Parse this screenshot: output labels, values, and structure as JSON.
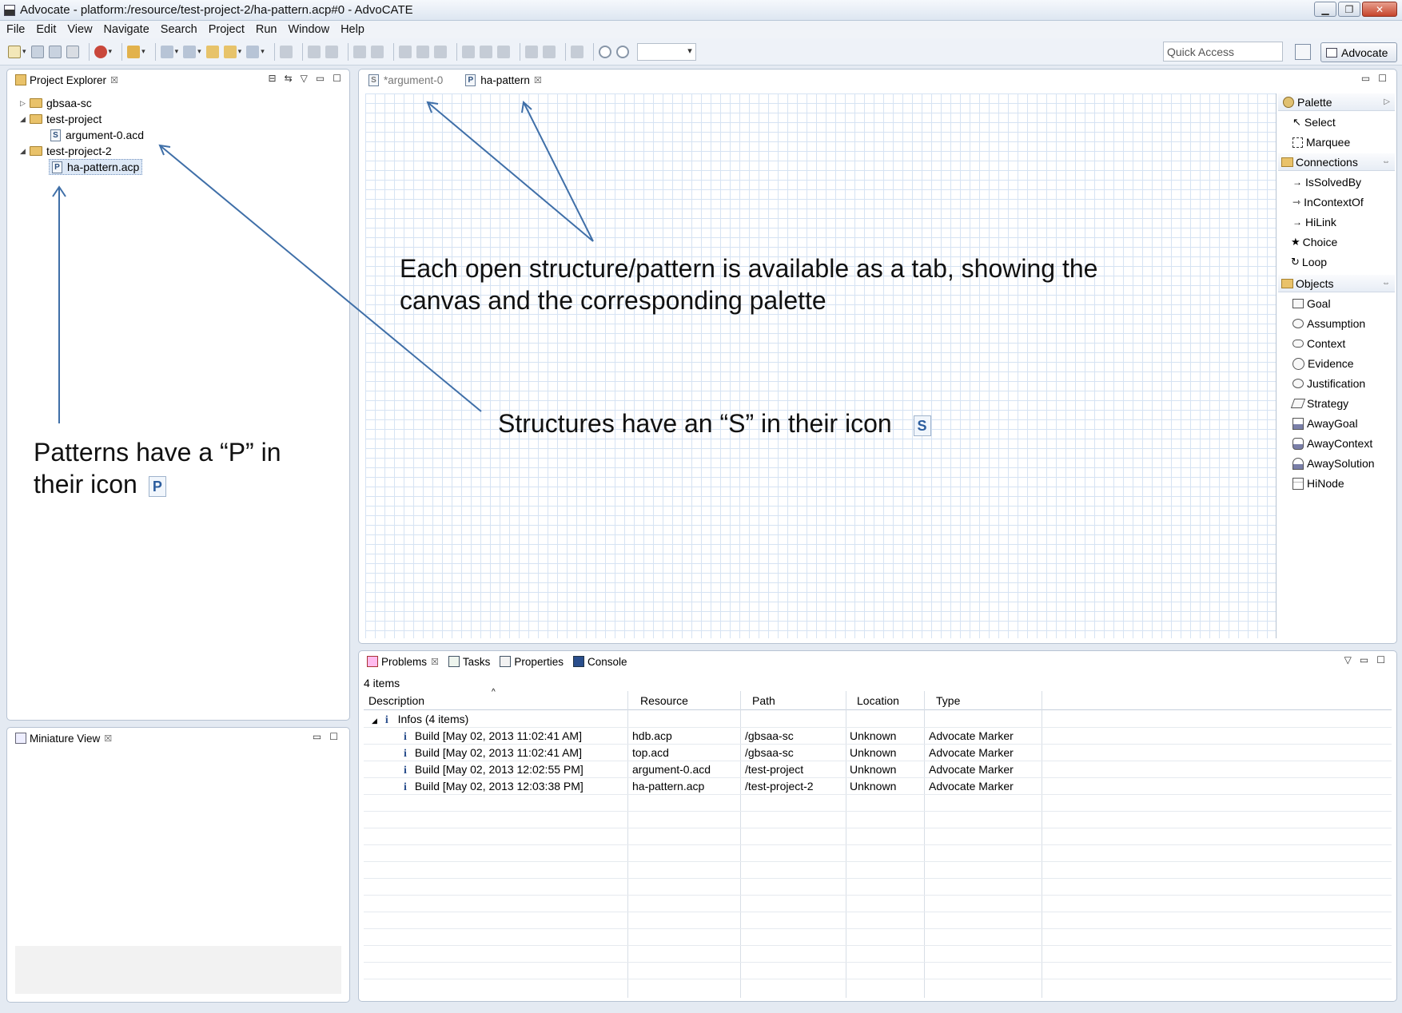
{
  "window": {
    "title": "Advocate - platform:/resource/test-project-2/ha-pattern.acp#0 - AdvoCATE",
    "controls": [
      "minimize",
      "restore",
      "close"
    ]
  },
  "menu": [
    "File",
    "Edit",
    "View",
    "Navigate",
    "Search",
    "Project",
    "Run",
    "Window",
    "Help"
  ],
  "toolbar": {
    "quick_access_placeholder": "Quick Access",
    "perspective_label": "Advocate"
  },
  "project_explorer": {
    "title": "Project Explorer",
    "nodes": [
      {
        "label": "gbsaa-sc",
        "type": "project",
        "expanded": false
      },
      {
        "label": "test-project",
        "type": "project",
        "expanded": true
      },
      {
        "label": "argument-0.acd",
        "type": "structure",
        "icon_letter": "S"
      },
      {
        "label": "test-project-2",
        "type": "project",
        "expanded": true
      },
      {
        "label": "ha-pattern.acp",
        "type": "pattern",
        "icon_letter": "P",
        "selected": true
      }
    ]
  },
  "miniature_view": {
    "title": "Miniature View"
  },
  "editor": {
    "tabs": [
      {
        "label": "*argument-0",
        "icon_letter": "S",
        "active": false
      },
      {
        "label": "ha-pattern",
        "icon_letter": "P",
        "active": true
      }
    ]
  },
  "palette": {
    "title": "Palette",
    "tools": [
      "Select",
      "Marquee"
    ],
    "connections_header": "Connections",
    "connections": [
      "IsSolvedBy",
      "InContextOf",
      "HiLink",
      "Choice",
      "Loop"
    ],
    "objects_header": "Objects",
    "objects": [
      "Goal",
      "Assumption",
      "Context",
      "Evidence",
      "Justification",
      "Strategy",
      "AwayGoal",
      "AwayContext",
      "AwaySolution",
      "HiNode"
    ]
  },
  "bottom_views": {
    "tabs": [
      "Problems",
      "Tasks",
      "Properties",
      "Console"
    ],
    "items_count": "4 items",
    "columns": [
      "Description",
      "Resource",
      "Path",
      "Location",
      "Type"
    ],
    "group_label": "Infos (4 items)",
    "rows": [
      {
        "description": "Build [May 02, 2013 11:02:41 AM]",
        "resource": "hdb.acp",
        "path": "/gbsaa-sc",
        "location": "Unknown",
        "type": "Advocate Marker"
      },
      {
        "description": "Build [May 02, 2013 11:02:41 AM]",
        "resource": "top.acd",
        "path": "/gbsaa-sc",
        "location": "Unknown",
        "type": "Advocate Marker"
      },
      {
        "description": "Build [May 02, 2013 12:02:55 PM]",
        "resource": "argument-0.acd",
        "path": "/test-project",
        "location": "Unknown",
        "type": "Advocate Marker"
      },
      {
        "description": "Build [May 02, 2013 12:03:38 PM]",
        "resource": "ha-pattern.acp",
        "path": "/test-project-2",
        "location": "Unknown",
        "type": "Advocate Marker"
      }
    ]
  },
  "annotations": {
    "tabs_note_line1": "Each open structure/pattern is available as a tab, showing the",
    "tabs_note_line2": "canvas and the corresponding palette",
    "structures_note": "Structures have an “S” in their icon",
    "patterns_note_line1": "Patterns have a “P” in",
    "patterns_note_line2": "their icon",
    "structure_icon_letter": "S",
    "pattern_icon_letter": "P"
  },
  "colors": {
    "annotation_arrow": "#3f6fa8",
    "grid_line": "#d6e3f3",
    "view_border": "#b7c3d3"
  }
}
